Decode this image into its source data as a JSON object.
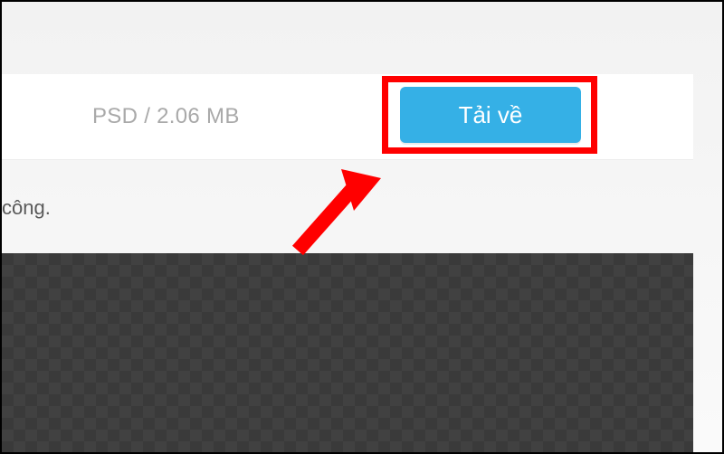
{
  "file": {
    "info": "PSD / 2.06 MB"
  },
  "actions": {
    "download_label": "Tải về"
  },
  "status": {
    "text": "công."
  },
  "annotation": {
    "highlight_color": "#ff0000",
    "arrow_color": "#ff0000"
  }
}
